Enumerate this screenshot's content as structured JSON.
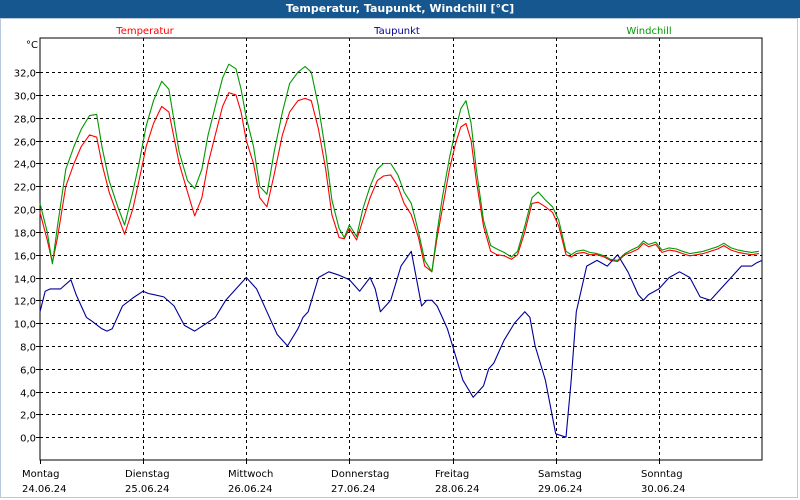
{
  "window": {
    "title": "Temperatur, Taupunkt, Windchill [°C]"
  },
  "chart_data": {
    "type": "line",
    "title": "Temperatur, Taupunkt, Windchill [°C]",
    "ylabel": "°C",
    "ylim": [
      -2,
      35
    ],
    "xlim": [
      0,
      7
    ],
    "grid": true,
    "legend_position": "top",
    "y_ticks": [
      "0,0",
      "2,0",
      "4,0",
      "6,0",
      "8,0",
      "10,0",
      "12,0",
      "14,0",
      "16,0",
      "18,0",
      "20,0",
      "22,0",
      "24,0",
      "26,0",
      "28,0",
      "30,0",
      "32,0"
    ],
    "y_tick_values": [
      0,
      2,
      4,
      6,
      8,
      10,
      12,
      14,
      16,
      18,
      20,
      22,
      24,
      26,
      28,
      30,
      32
    ],
    "x_ticks": [
      {
        "day": "Montag",
        "date": "24.06.24"
      },
      {
        "day": "Dienstag",
        "date": "25.06.24"
      },
      {
        "day": "Mittwoch",
        "date": "26.06.24"
      },
      {
        "day": "Donnerstag",
        "date": "27.06.24"
      },
      {
        "day": "Freitag",
        "date": "28.06.24"
      },
      {
        "day": "Samstag",
        "date": "29.06.24"
      },
      {
        "day": "Sonntag",
        "date": "30.06.24"
      }
    ],
    "series": [
      {
        "name": "Temperatur",
        "color": "#ff0000",
        "legend_align": "left",
        "x": [
          0,
          0.07,
          0.12,
          0.17,
          0.25,
          0.33,
          0.4,
          0.48,
          0.55,
          0.6,
          0.67,
          0.75,
          0.82,
          0.9,
          0.96,
          1.03,
          1.1,
          1.18,
          1.25,
          1.35,
          1.43,
          1.5,
          1.57,
          1.63,
          1.7,
          1.77,
          1.83,
          1.9,
          1.95,
          2,
          2.07,
          2.13,
          2.2,
          2.27,
          2.35,
          2.42,
          2.5,
          2.57,
          2.63,
          2.7,
          2.77,
          2.83,
          2.9,
          2.95,
          3,
          3.07,
          3.13,
          3.2,
          3.27,
          3.33,
          3.4,
          3.47,
          3.53,
          3.6,
          3.67,
          3.73,
          3.8,
          3.85,
          3.9,
          3.97,
          4.03,
          4.08,
          4.13,
          4.18,
          4.23,
          4.3,
          4.37,
          4.43,
          4.5,
          4.57,
          4.63,
          4.7,
          4.77,
          4.83,
          4.9,
          4.97,
          5.03,
          5.1,
          5.15,
          5.2,
          5.27,
          5.33,
          5.4,
          5.47,
          5.53,
          5.6,
          5.67,
          5.73,
          5.8,
          5.85,
          5.9,
          5.97,
          6.03,
          6.1,
          6.17,
          6.23,
          6.3,
          6.37,
          6.43,
          6.5,
          6.57,
          6.63,
          6.7,
          6.77,
          6.83,
          6.9,
          6.97
        ],
        "values": [
          19.7,
          17.3,
          15.3,
          17.5,
          22,
          24,
          25.5,
          26.5,
          26.3,
          24,
          21.5,
          19.5,
          17.8,
          20,
          22.5,
          25.5,
          27.5,
          29,
          28.5,
          24,
          21.5,
          19.4,
          21,
          24,
          26.5,
          29,
          30.2,
          30,
          28.5,
          26,
          24,
          21,
          20.2,
          23,
          26.5,
          28.5,
          29.5,
          29.7,
          29.5,
          27,
          23.5,
          19.5,
          17.5,
          17.4,
          18.3,
          17.3,
          19,
          21,
          22.5,
          22.9,
          23,
          22,
          20.5,
          19.5,
          17.5,
          15,
          14.5,
          17.5,
          20,
          23.5,
          25.8,
          27.2,
          27.5,
          26,
          22.5,
          18.5,
          16.3,
          16,
          15.9,
          15.6,
          16,
          18,
          20.5,
          20.6,
          20.2,
          19.7,
          18.5,
          16,
          15.8,
          16.1,
          16.2,
          16,
          16,
          15.8,
          15.5,
          15.4,
          16,
          16.2,
          16.5,
          17,
          16.7,
          16.9,
          16.2,
          16.4,
          16.3,
          16.1,
          15.9,
          16,
          16.1,
          16.3,
          16.5,
          16.8,
          16.4,
          16.2,
          16.1,
          16,
          16.1
        ]
      },
      {
        "name": "Taupunkt",
        "color": "#00009a",
        "legend_align": "center",
        "x": [
          0,
          0.05,
          0.1,
          0.2,
          0.3,
          0.35,
          0.45,
          0.5,
          0.6,
          0.65,
          0.7,
          0.8,
          0.9,
          1,
          1.05,
          1.1,
          1.2,
          1.3,
          1.4,
          1.5,
          1.6,
          1.7,
          1.8,
          1.9,
          2,
          2.1,
          2.2,
          2.3,
          2.4,
          2.5,
          2.55,
          2.6,
          2.7,
          2.8,
          2.9,
          3,
          3.1,
          3.2,
          3.25,
          3.3,
          3.4,
          3.5,
          3.6,
          3.7,
          3.75,
          3.8,
          3.85,
          3.9,
          3.95,
          4,
          4.1,
          4.2,
          4.3,
          4.35,
          4.4,
          4.5,
          4.6,
          4.7,
          4.75,
          4.8,
          4.9,
          5,
          5.1,
          5.15,
          5.2,
          5.3,
          5.4,
          5.5,
          5.6,
          5.7,
          5.8,
          5.85,
          5.9,
          6,
          6.1,
          6.2,
          6.3,
          6.4,
          6.5,
          6.6,
          6.7,
          6.8,
          6.9,
          6.95,
          7
        ],
        "values": [
          11,
          12.8,
          13,
          13,
          13.8,
          12.5,
          10.5,
          10.2,
          9.5,
          9.3,
          9.5,
          11.5,
          12.2,
          12.8,
          12.6,
          12.5,
          12.3,
          11.5,
          9.8,
          9.3,
          9.9,
          10.5,
          12,
          13,
          14,
          13,
          11,
          9,
          8,
          9.5,
          10.5,
          11,
          14,
          14.5,
          14.2,
          13.8,
          12.8,
          14,
          13,
          11,
          12,
          15,
          16.3,
          11.5,
          12,
          12,
          11.5,
          10.5,
          9.5,
          8,
          5,
          3.5,
          4.5,
          6,
          6.5,
          8.5,
          10,
          11,
          10.5,
          8,
          5,
          0.3,
          0,
          5,
          11,
          15,
          15.5,
          15,
          16,
          14.5,
          12.5,
          12,
          12.5,
          13,
          14,
          14.5,
          14,
          12.3,
          12,
          13,
          14,
          15,
          15,
          15.3,
          15.5
        ]
      },
      {
        "name": "Windchill",
        "color": "#009900",
        "legend_align": "right",
        "x": [
          0,
          0.07,
          0.12,
          0.17,
          0.25,
          0.33,
          0.4,
          0.48,
          0.55,
          0.6,
          0.67,
          0.75,
          0.82,
          0.9,
          0.96,
          1.03,
          1.1,
          1.18,
          1.25,
          1.35,
          1.43,
          1.5,
          1.57,
          1.63,
          1.7,
          1.77,
          1.83,
          1.9,
          1.95,
          2,
          2.07,
          2.13,
          2.2,
          2.27,
          2.35,
          2.42,
          2.5,
          2.57,
          2.63,
          2.7,
          2.77,
          2.83,
          2.9,
          2.95,
          3,
          3.07,
          3.13,
          3.2,
          3.27,
          3.33,
          3.4,
          3.47,
          3.53,
          3.6,
          3.67,
          3.73,
          3.8,
          3.85,
          3.9,
          3.97,
          4.03,
          4.08,
          4.13,
          4.18,
          4.23,
          4.3,
          4.37,
          4.43,
          4.5,
          4.57,
          4.63,
          4.7,
          4.77,
          4.83,
          4.9,
          4.97,
          5.03,
          5.1,
          5.15,
          5.2,
          5.27,
          5.33,
          5.4,
          5.47,
          5.53,
          5.6,
          5.67,
          5.73,
          5.8,
          5.85,
          5.9,
          5.97,
          6.03,
          6.1,
          6.17,
          6.23,
          6.3,
          6.37,
          6.43,
          6.5,
          6.57,
          6.63,
          6.7,
          6.77,
          6.83,
          6.9,
          6.97
        ],
        "values": [
          20.5,
          18,
          15.2,
          18.5,
          23.5,
          25.5,
          27,
          28.2,
          28.3,
          25.5,
          22.5,
          20.3,
          18.6,
          21.5,
          24,
          27.3,
          29.5,
          31.2,
          30.5,
          25,
          22.5,
          21.8,
          23.5,
          26.5,
          29,
          31.5,
          32.7,
          32.3,
          30.5,
          28,
          25.5,
          22,
          21.3,
          25,
          28.5,
          31,
          32,
          32.5,
          32,
          29,
          25,
          20.8,
          18.3,
          17.5,
          18.6,
          17.6,
          20,
          22,
          23.5,
          24,
          24,
          23,
          21.5,
          20.5,
          18,
          15.5,
          14.5,
          18,
          21,
          24.5,
          27,
          28.8,
          29.5,
          27.5,
          23.5,
          19,
          16.8,
          16.5,
          16.2,
          15.8,
          16.3,
          18.5,
          21,
          21.5,
          20.8,
          20.2,
          19,
          16.3,
          16,
          16.3,
          16.4,
          16.2,
          16.1,
          15.9,
          15.6,
          15.5,
          16.1,
          16.4,
          16.7,
          17.2,
          16.9,
          17.1,
          16.4,
          16.6,
          16.5,
          16.3,
          16.1,
          16.2,
          16.3,
          16.5,
          16.7,
          17,
          16.6,
          16.4,
          16.3,
          16.2,
          16.3
        ]
      }
    ]
  }
}
